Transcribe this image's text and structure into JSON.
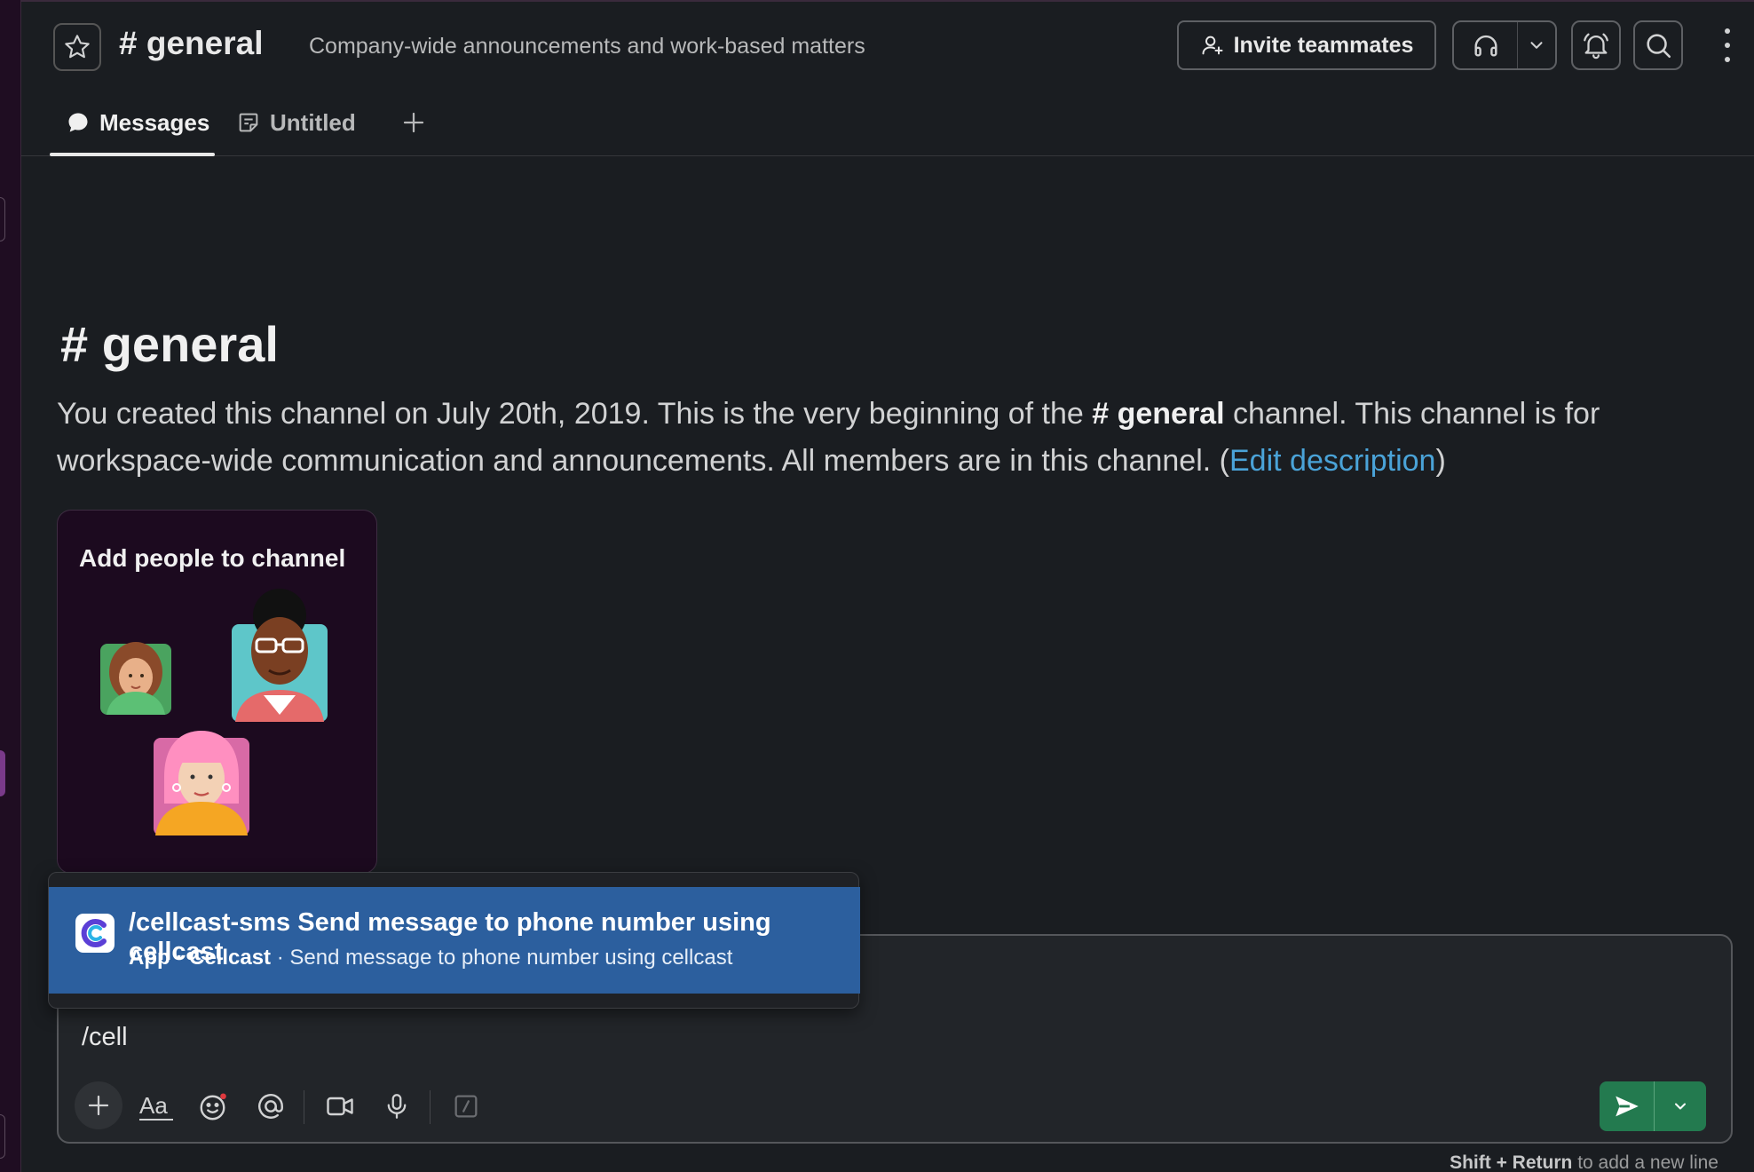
{
  "header": {
    "channel_hash": "#",
    "channel_name": "general",
    "topic": "Company-wide announcements and work-based matters",
    "invite_label": "Invite teammates"
  },
  "tabs": [
    {
      "label": "Messages",
      "icon": "chat-bubble-icon",
      "active": true
    },
    {
      "label": "Untitled",
      "icon": "canvas-icon",
      "active": false
    }
  ],
  "intro": {
    "title_hash": "#",
    "title_name": "general",
    "text_part1": "You created this channel on July 20th, 2019. This is the very beginning of the ",
    "text_channel": "# general",
    "text_part2": " channel. This channel is for workspace-wide communication and announcements. All members are in this channel. (",
    "edit_link": "Edit description",
    "text_part3": ")"
  },
  "people_card": {
    "title": "Add people to channel"
  },
  "autocomplete": {
    "command": "/cellcast-sms",
    "title_desc": "Send message to phone number using cellcast",
    "sub_app": "App",
    "sub_name": "Cellcast",
    "sub_desc": "Send message to phone number using cellcast"
  },
  "composer": {
    "value": "/cell",
    "hint_keys": "Shift + Return",
    "hint_text": "to add a new line"
  },
  "colors": {
    "background": "#1a1d21",
    "accent_blue": "#2c5f9e",
    "send_green": "#237a4f",
    "link": "#4aa3d8"
  }
}
